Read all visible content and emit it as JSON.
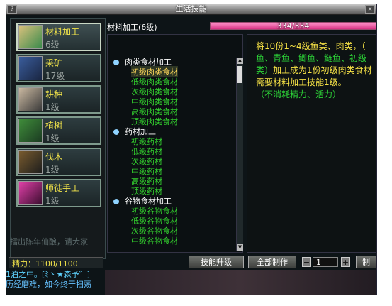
{
  "window": {
    "title": "生活技能",
    "help_btn": "?",
    "close_btn": "x"
  },
  "skills": [
    {
      "name": "材料加工",
      "level": "6级",
      "selected": true,
      "icon": "materials-icon"
    },
    {
      "name": "采矿",
      "level": "17级",
      "selected": false,
      "icon": "pickaxe-icon"
    },
    {
      "name": "耕种",
      "level": "1级",
      "selected": false,
      "icon": "hoe-icon"
    },
    {
      "name": "植树",
      "level": "1级",
      "selected": false,
      "icon": "tree-icon"
    },
    {
      "name": "伐木",
      "level": "1级",
      "selected": false,
      "icon": "axe-icon"
    },
    {
      "name": "师徒手工",
      "level": "1级",
      "selected": false,
      "icon": "crafting-icon"
    }
  ],
  "header": {
    "label": "材料加工(6级)",
    "progress_text": "334/334",
    "progress_fraction": 1.0
  },
  "list": [
    {
      "type": "cat",
      "text": "肉类食材加工"
    },
    {
      "type": "item",
      "text": "初级肉类食材",
      "selected": true
    },
    {
      "type": "item",
      "text": "低级肉类食材"
    },
    {
      "type": "item",
      "text": "次级肉类食材"
    },
    {
      "type": "item",
      "text": "中级肉类食材"
    },
    {
      "type": "item",
      "text": "高级肉类食材"
    },
    {
      "type": "item",
      "text": "顶级肉类食材"
    },
    {
      "type": "cat",
      "text": "药材加工"
    },
    {
      "type": "item",
      "text": "初级药材"
    },
    {
      "type": "item",
      "text": "低级药材"
    },
    {
      "type": "item",
      "text": "次级药材"
    },
    {
      "type": "item",
      "text": "中级药材"
    },
    {
      "type": "item",
      "text": "高级药材"
    },
    {
      "type": "item",
      "text": "顶级药材"
    },
    {
      "type": "cat",
      "text": "谷物食材加工"
    },
    {
      "type": "item",
      "text": "初级谷物食材"
    },
    {
      "type": "item",
      "text": "低级谷物食材"
    },
    {
      "type": "item",
      "text": "次级谷物食材"
    },
    {
      "type": "item",
      "text": "中级谷物食材"
    }
  ],
  "description": {
    "line1": "将10份1~4级鱼类、肉类，（",
    "line2": "鱼、青鱼、鲫鱼、鲢鱼、初级",
    "line3_green": "类）",
    "line3_rest": "加工成为1份初级肉类食材",
    "line4": "需要材料加工技能1级。",
    "line5": "（不消耗精力、活力）"
  },
  "status": {
    "energy": "精力：1100/1100"
  },
  "buttons": {
    "upgrade": "技能升级",
    "make_all": "全部制作",
    "minus": "−",
    "plus": "+",
    "make": "制"
  },
  "quantity": "1",
  "chat": {
    "line1": "1泊之中。[ﾐ丶★森予゛]",
    "line2": "历经磨难，如今终于扫荡"
  },
  "background_text": "擂出陈年仙酿，请大家"
}
